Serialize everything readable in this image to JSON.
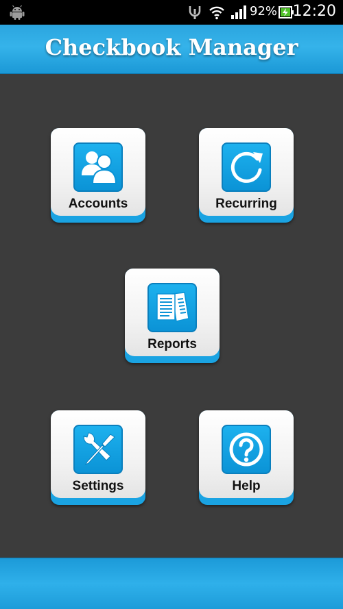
{
  "status_bar": {
    "battery_percent": "92%",
    "time": "12:20",
    "icons": [
      "android-icon",
      "usb-icon",
      "wifi-icon",
      "signal-icon",
      "battery-charging-icon"
    ]
  },
  "app": {
    "title": "Checkbook Manager"
  },
  "menu": {
    "accounts": {
      "label": "Accounts",
      "icon": "accounts-icon"
    },
    "recurring": {
      "label": "Recurring",
      "icon": "recurring-icon"
    },
    "reports": {
      "label": "Reports",
      "icon": "reports-icon"
    },
    "settings": {
      "label": "Settings",
      "icon": "settings-icon"
    },
    "help": {
      "label": "Help",
      "icon": "help-icon"
    }
  },
  "colors": {
    "accent": "#1aa3e2",
    "background": "#3c3c3c",
    "status_bar": "#000000"
  }
}
